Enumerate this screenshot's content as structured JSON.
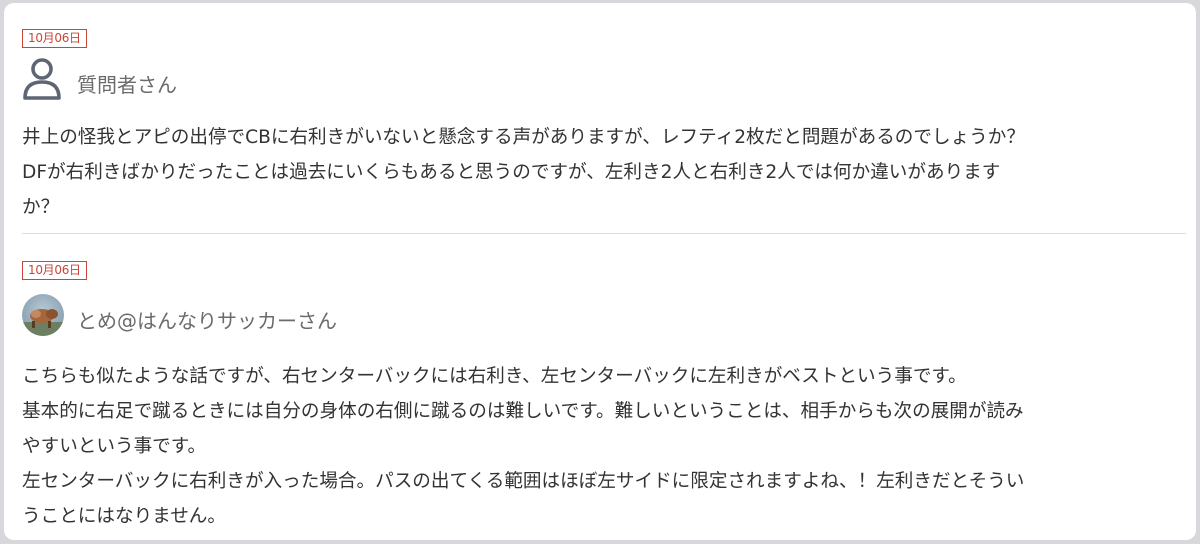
{
  "question": {
    "date": "10月06日",
    "author": "質問者さん",
    "avatar_icon": "user-outline-icon",
    "lines": [
      "井上の怪我とアピの出停でCBに右利きがいないと懸念する声がありますが、レフティ2枚だと問題があるのでしょうか？",
      "DFが右利きばかりだったことは過去にいくらもあると思うのですが、左利き2人と右利き2人では何か違いがあります",
      "か？"
    ]
  },
  "answer": {
    "date": "10月06日",
    "author": "とめ@はんなりサッカーさん",
    "avatar_icon": "user-photo-avatar",
    "lines": [
      "こちらも似たような話ですが、右センターバックには右利き、左センターバックに左利きがベストという事です。",
      "基本的に右足で蹴るときには自分の身体の右側に蹴るのは難しいです。難しいということは、相手からも次の展開が読み",
      "やすいという事です。",
      "左センターバックに右利きが入った場合。パスの出てくる範囲はほぼ左サイドに限定されますよね、！左利きだとそうい",
      "うことにはなりません。"
    ]
  },
  "colors": {
    "date_accent": "#c9453a",
    "author_text": "#6b6b6b",
    "body_text": "#333333",
    "divider": "#dedede"
  }
}
